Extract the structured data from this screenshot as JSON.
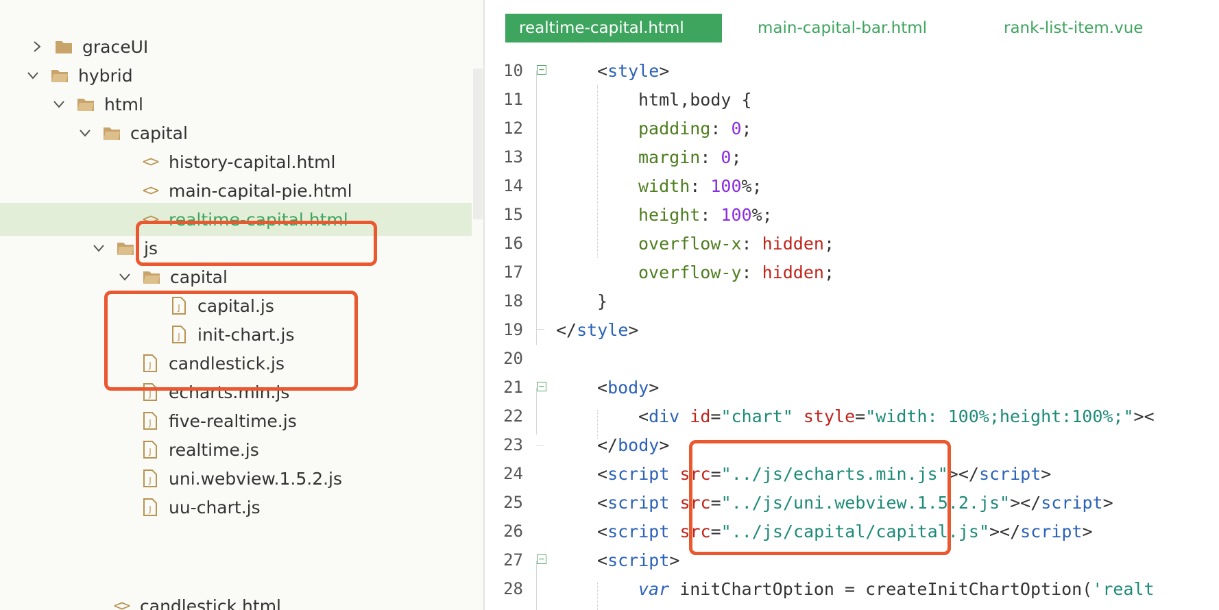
{
  "colors": {
    "accent_green": "#3ea55e",
    "highlight_red": "#e9582f",
    "selected_row_bg": "#e3eed8",
    "folder_icon": "#c9a46a",
    "file_icon": "#b89452"
  },
  "sidebar": {
    "items": [
      {
        "label": "graceUI",
        "arrow": "chevron-right",
        "icon": "folder-closed"
      },
      {
        "label": "hybrid",
        "arrow": "chevron-down",
        "icon": "folder-open"
      },
      {
        "label": "html",
        "arrow": "chevron-down",
        "icon": "folder-open"
      },
      {
        "label": "capital",
        "arrow": "chevron-down",
        "icon": "folder-open"
      },
      {
        "label": "history-capital.html",
        "icon": "code-file",
        "icon_text": "<>"
      },
      {
        "label": "main-capital-pie.html",
        "icon": "code-file",
        "icon_text": "<>"
      },
      {
        "label": "realtime-capital.html",
        "icon": "code-file",
        "icon_text": "<>",
        "selected": true
      },
      {
        "label": "js",
        "arrow": "chevron-down",
        "icon": "folder-open"
      },
      {
        "label": "capital",
        "arrow": "chevron-down",
        "icon": "folder-open"
      },
      {
        "label": "capital.js",
        "icon": "js-file"
      },
      {
        "label": "init-chart.js",
        "icon": "js-file"
      },
      {
        "label": "candlestick.js",
        "icon": "js-file"
      },
      {
        "label": "echarts.min.js",
        "icon": "js-file"
      },
      {
        "label": "five-realtime.js",
        "icon": "js-file"
      },
      {
        "label": "realtime.js",
        "icon": "js-file"
      },
      {
        "label": "uni.webview.1.5.2.js",
        "icon": "js-file"
      },
      {
        "label": "uu-chart.js",
        "icon": "js-file"
      },
      {
        "label": "candlestick.html",
        "icon": "code-file",
        "icon_text": "<>"
      }
    ]
  },
  "tabs": [
    {
      "label": "realtime-capital.html",
      "active": true
    },
    {
      "label": "main-capital-bar.html",
      "active": false
    },
    {
      "label": "rank-list-item.vue",
      "active": false
    }
  ],
  "code": {
    "lines": [
      {
        "n": "10",
        "fold": "−"
      },
      {
        "n": "11"
      },
      {
        "n": "12"
      },
      {
        "n": "13"
      },
      {
        "n": "14"
      },
      {
        "n": "15"
      },
      {
        "n": "16"
      },
      {
        "n": "17"
      },
      {
        "n": "18"
      },
      {
        "n": "19"
      },
      {
        "n": "20"
      },
      {
        "n": "21",
        "fold": "−"
      },
      {
        "n": "22"
      },
      {
        "n": "23"
      },
      {
        "n": "24"
      },
      {
        "n": "25"
      },
      {
        "n": "26"
      },
      {
        "n": "27",
        "fold": "−"
      },
      {
        "n": "28"
      }
    ],
    "t": {
      "l10": {
        "a": "<",
        "b": "style",
        "c": ">"
      },
      "l11": {
        "a": "html,body {"
      },
      "l12": {
        "p": "padding",
        "c": ": ",
        "v": "0",
        "s": ";"
      },
      "l13": {
        "p": "margin",
        "c": ": ",
        "v": "0",
        "s": ";"
      },
      "l14": {
        "p": "width",
        "c": ": ",
        "v": "100",
        "s": "%;"
      },
      "l15": {
        "p": "height",
        "c": ": ",
        "v": "100",
        "s": "%;"
      },
      "l16": {
        "p": "overflow-x",
        "c": ": ",
        "v": "hidden",
        "s": ";"
      },
      "l17": {
        "p": "overflow-y",
        "c": ": ",
        "v": "hidden",
        "s": ";"
      },
      "l18": {
        "a": "}"
      },
      "l19": {
        "a": "</",
        "b": "style",
        "c": ">"
      },
      "l21": {
        "a": "<",
        "b": "body",
        "c": ">"
      },
      "l22": {
        "a": "<",
        "b": "div",
        "sp1": " ",
        "at1": "id",
        "eq1": "=",
        "s1": "\"chart\"",
        "sp2": " ",
        "at2": "style",
        "eq2": "=",
        "s2": "\"width: 100%;height:100%;\"",
        "e": "><"
      },
      "l23": {
        "a": "</",
        "b": "body",
        "c": ">"
      },
      "l24": {
        "a": "<",
        "b": "script",
        "sp": " ",
        "at": "src",
        "eq": "=",
        "s": "\"../js/echarts.min.js\"",
        "m": "></",
        "b2": "script",
        "c": ">"
      },
      "l25": {
        "a": "<",
        "b": "script",
        "sp": " ",
        "at": "src",
        "eq": "=",
        "s": "\"../js/uni.webview.1.5.2.js\"",
        "m": "></",
        "b2": "script",
        "c": ">"
      },
      "l26": {
        "a": "<",
        "b": "script",
        "sp": " ",
        "at": "src",
        "eq": "=",
        "s": "\"../js/capital/capital.js\"",
        "m": "></",
        "b2": "script",
        "c": ">"
      },
      "l27": {
        "a": "<",
        "b": "script",
        "c": ">"
      },
      "l28": {
        "kw": "var",
        "id": " initChartOption = createInitChartOption(",
        "s": "'realt"
      }
    }
  }
}
